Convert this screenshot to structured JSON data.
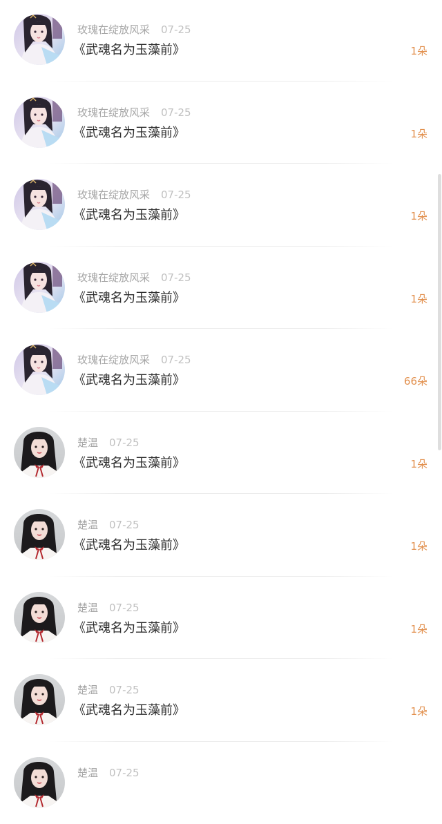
{
  "items": [
    {
      "user": "玫瑰在绽放风采",
      "date": "07-25",
      "title": "《武魂名为玉藻前》",
      "amount": "1朵",
      "avatar": "avatar-a"
    },
    {
      "user": "玫瑰在绽放风采",
      "date": "07-25",
      "title": "《武魂名为玉藻前》",
      "amount": "1朵",
      "avatar": "avatar-a"
    },
    {
      "user": "玫瑰在绽放风采",
      "date": "07-25",
      "title": "《武魂名为玉藻前》",
      "amount": "1朵",
      "avatar": "avatar-a"
    },
    {
      "user": "玫瑰在绽放风采",
      "date": "07-25",
      "title": "《武魂名为玉藻前》",
      "amount": "1朵",
      "avatar": "avatar-a"
    },
    {
      "user": "玫瑰在绽放风采",
      "date": "07-25",
      "title": "《武魂名为玉藻前》",
      "amount": "66朵",
      "avatar": "avatar-a"
    },
    {
      "user": "楚温",
      "date": "07-25",
      "title": "《武魂名为玉藻前》",
      "amount": "1朵",
      "avatar": "avatar-b"
    },
    {
      "user": "楚温",
      "date": "07-25",
      "title": "《武魂名为玉藻前》",
      "amount": "1朵",
      "avatar": "avatar-b"
    },
    {
      "user": "楚温",
      "date": "07-25",
      "title": "《武魂名为玉藻前》",
      "amount": "1朵",
      "avatar": "avatar-b"
    },
    {
      "user": "楚温",
      "date": "07-25",
      "title": "《武魂名为玉藻前》",
      "amount": "1朵",
      "avatar": "avatar-b"
    },
    {
      "user": "楚温",
      "date": "07-25",
      "title": "",
      "amount": "",
      "avatar": "avatar-b"
    }
  ],
  "colors": {
    "background": "#ffffff",
    "username": "#a6a6a6",
    "date": "#c0c0c0",
    "title": "#2e2e2e",
    "amount": "#e2904e",
    "divider": "#ececec",
    "scrollbar": "#dedede"
  }
}
